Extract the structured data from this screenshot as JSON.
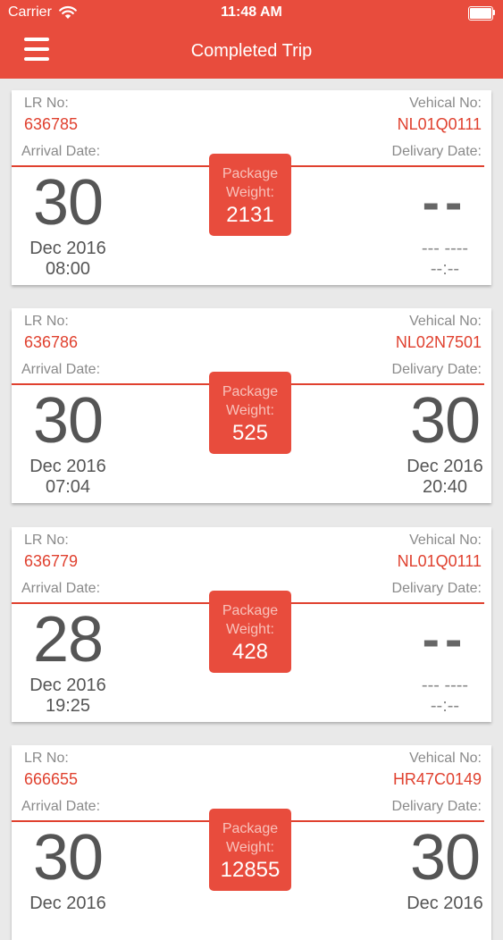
{
  "status_bar": {
    "carrier": "Carrier",
    "time": "11:48 AM"
  },
  "header": {
    "title": "Completed Trip",
    "menu_icon": "hamburger-menu-icon"
  },
  "labels": {
    "lr_no": "LR No:",
    "vehicle_no": "Vehical No:",
    "arrival_date": "Arrival Date:",
    "delivery_date": "Delivary Date:",
    "package_weight": "Package Weight:"
  },
  "colors": {
    "accent": "#e84c3d",
    "value_text": "#e0412f"
  },
  "trips": [
    {
      "lr_no": "636785",
      "vehicle_no": "NL01Q0111",
      "package_weight": "2131",
      "arrival": {
        "day": "30",
        "month_year": "Dec 2016",
        "time": "08:00"
      },
      "delivery": {
        "day": "--",
        "month_year": "--- ----",
        "time": "--:--"
      }
    },
    {
      "lr_no": "636786",
      "vehicle_no": "NL02N7501",
      "package_weight": "525",
      "arrival": {
        "day": "30",
        "month_year": "Dec 2016",
        "time": "07:04"
      },
      "delivery": {
        "day": "30",
        "month_year": "Dec 2016",
        "time": "20:40"
      }
    },
    {
      "lr_no": "636779",
      "vehicle_no": "NL01Q0111",
      "package_weight": "428",
      "arrival": {
        "day": "28",
        "month_year": "Dec 2016",
        "time": "19:25"
      },
      "delivery": {
        "day": "--",
        "month_year": "--- ----",
        "time": "--:--"
      }
    },
    {
      "lr_no": "666655",
      "vehicle_no": "HR47C0149",
      "package_weight": "12855",
      "arrival": {
        "day": "30",
        "month_year": "Dec 2016",
        "time": ""
      },
      "delivery": {
        "day": "30",
        "month_year": "Dec 2016",
        "time": ""
      }
    }
  ]
}
